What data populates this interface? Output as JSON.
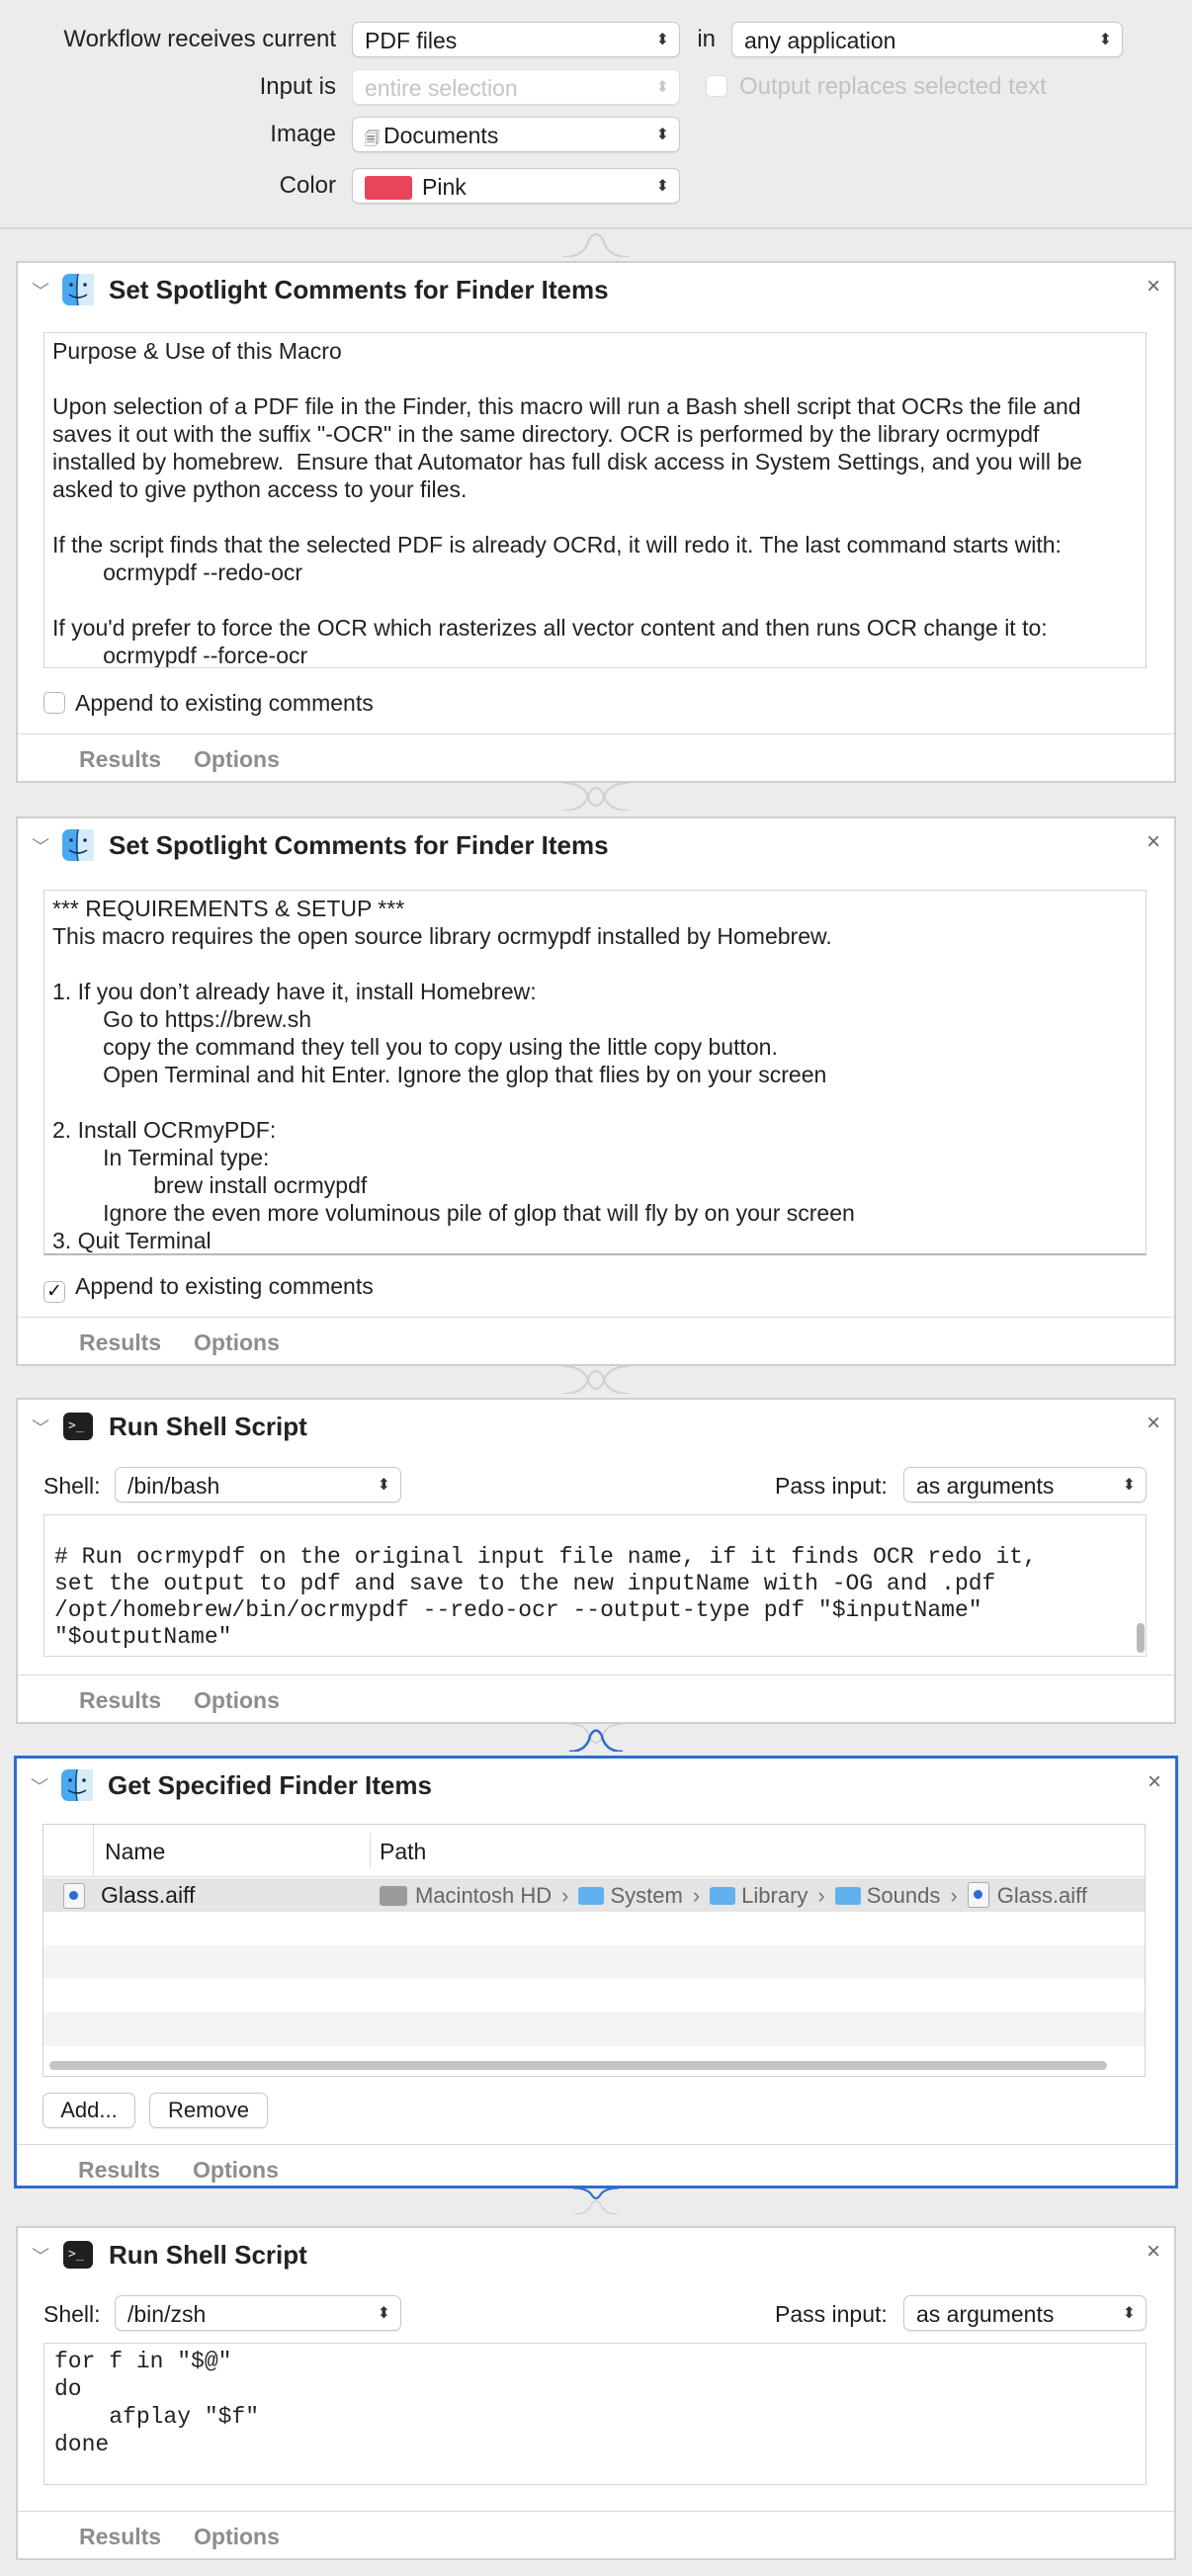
{
  "header": {
    "workflow_label": "Workflow receives current",
    "workflow_value": "PDF files",
    "in_label": "in",
    "in_value": "any application",
    "input_is_label": "Input is",
    "input_is_value": "entire selection",
    "output_replaces_label": "Output replaces selected text",
    "image_label": "Image",
    "image_value": "Documents",
    "color_label": "Color",
    "color_value": "Pink",
    "color_swatch": "#e9445a"
  },
  "common": {
    "results_label": "Results",
    "options_label": "Options",
    "append_label": "Append to existing comments",
    "shell_label": "Shell:",
    "pass_input_label": "Pass input:",
    "close_glyph": "×"
  },
  "actions": [
    {
      "title": "Set Spotlight Comments for Finder Items",
      "icon": "finder-icon",
      "append_checked": false,
      "comments": "Purpose & Use of this Macro\n\nUpon selection of a PDF file in the Finder, this macro will run a Bash shell script that OCRs the file and\nsaves it out with the suffix \"-OCR\" in the same directory. OCR is performed by the library ocrmypdf\ninstalled by homebrew.  Ensure that Automator has full disk access in System Settings, and you will be\nasked to give python access to your files.\n\nIf the script finds that the selected PDF is already OCRd, it will redo it. The last command starts with:\n        ocrmypdf --redo-ocr\n\nIf you'd prefer to force the OCR which rasterizes all vector content and then runs OCR change it to:\n        ocrmypdf --force-ocr"
    },
    {
      "title": "Set Spotlight Comments for Finder Items",
      "icon": "finder-icon",
      "append_checked": true,
      "comments": "*** REQUIREMENTS & SETUP ***\nThis macro requires the open source library ocrmypdf installed by Homebrew.\n\n1. If you don’t already have it, install Homebrew:\n        Go to https://brew.sh\n        copy the command they tell you to copy using the little copy button.\n        Open Terminal and hit Enter. Ignore the glop that flies by on your screen\n\n2. Install OCRmyPDF:\n        In Terminal type:\n                brew install ocrmypdf\n        Ignore the even more voluminous pile of glop that will fly by on your screen\n3. Quit Terminal"
    },
    {
      "title": "Run Shell Script",
      "icon": "terminal-icon",
      "shell": "/bin/bash",
      "pass_input": "as arguments",
      "script": "\n# Run ocrmypdf on the original input file name, if it finds OCR redo it,\nset the output to pdf and save to the new inputName with -OG and .pdf\n/opt/homebrew/bin/ocrmypdf --redo-ocr --output-type pdf \"$inputName\"\n\"$outputName\""
    },
    {
      "title": "Get Specified Finder Items",
      "icon": "finder-icon",
      "columns": [
        "Name",
        "Path"
      ],
      "items": [
        {
          "name": "Glass.aiff",
          "path": [
            "Macintosh HD",
            "System",
            "Library",
            "Sounds",
            "Glass.aiff"
          ]
        }
      ],
      "add_label": "Add...",
      "remove_label": "Remove"
    },
    {
      "title": "Run Shell Script",
      "icon": "terminal-icon",
      "shell": "/bin/zsh",
      "pass_input": "as arguments",
      "script": "for f in \"$@\"\ndo\n    afplay \"$f\"\ndone"
    }
  ],
  "accent_color": "#2f6cd0"
}
